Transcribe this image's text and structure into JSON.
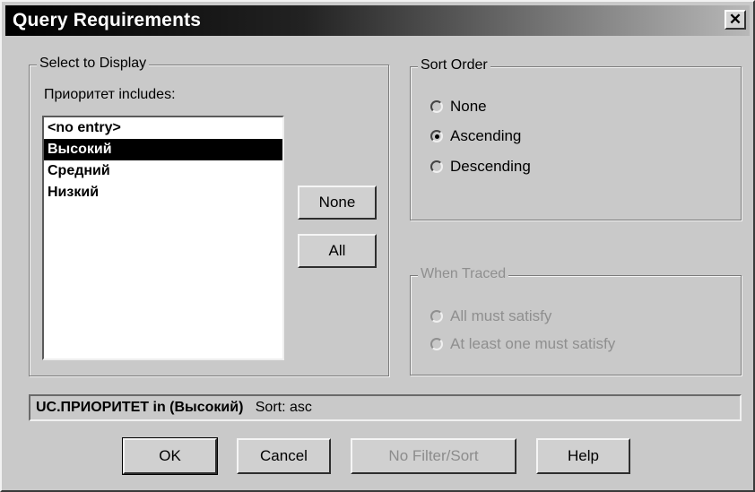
{
  "window": {
    "title": "Query Requirements",
    "close_glyph": "✕"
  },
  "select_display": {
    "legend": "Select to Display",
    "label": "Приоритет includes:",
    "items": [
      "<no entry>",
      "Высокий",
      "Средний",
      "Низкий"
    ],
    "selected_index": 1
  },
  "buttons": {
    "none": "None",
    "all": "All"
  },
  "sort_order": {
    "legend": "Sort Order",
    "options": [
      "None",
      "Ascending",
      "Descending"
    ],
    "selected_index": 1
  },
  "when_traced": {
    "legend": "When Traced",
    "options": [
      "All must satisfy",
      "At least one must satisfy"
    ],
    "enabled": false
  },
  "status": {
    "field": "UC.ПРИОРИТЕТ in (Высокий)",
    "sort": "Sort: asc"
  },
  "footer": {
    "ok": "OK",
    "cancel": "Cancel",
    "no_filter": "No Filter/Sort",
    "help": "Help"
  }
}
